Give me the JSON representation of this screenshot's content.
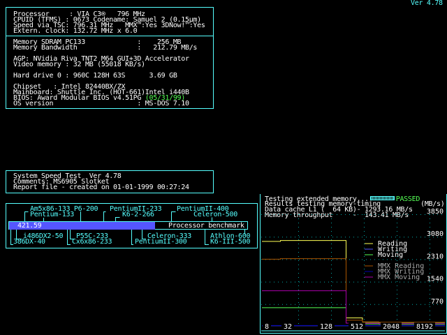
{
  "version": "Ver 4.78",
  "system": {
    "cpu": [
      "Processor     : VIA C3®   796 MHz",
      "CPUID (TFMS) : 0673 Codename: Samuel 2 (0.15µm)",
      "Speed via TSC: 796.31 MHz   MMX™:Yes 3DNow!™:Yes",
      "Extern. clock: 132.72 MHz x 6.0"
    ],
    "memory": [
      "Memory SDRAM PC133             :    256 MB",
      "Memory Bandwidth               :   212.79 MB/s"
    ],
    "video": [
      "AGP: NVidia Riva TNT2 M64 GUI+3D Accelerator",
      "Video memory : 32 MB (55018 KB/s)"
    ],
    "disk": "Hard drive 0 : 960C 128H 63S      3.69 GB",
    "chipset": "Chipset   : Intel 82440BX/ZX",
    "mainboard": "Mainboard: Shuttle Inc. (HOT-661)Intel i440B",
    "bios": "BIOS: Award Modular BIOS v4.51PG",
    "bios_date": "(05/31/99)",
    "os": "OS version                     : MS-DOS 7.10"
  },
  "report": [
    "System Speed Test  Ver 4.78",
    "Comments: MS6905 Slotket",
    "Report file - created on 01-01-1999 00:27:24"
  ],
  "benchmark": {
    "score": "421.59",
    "score_value": 421.59,
    "label": "Processor benchmark",
    "above": [
      "Am5x86-133 P6-200",
      "PentiumII-233",
      "PentiumII-400",
      "Pentium-133",
      "K6-2-266",
      "Celeron-500"
    ],
    "below": [
      "i486DX2-50",
      "P55C-233",
      "Celeron-333",
      "Athlon-600",
      "386DX-40",
      "Cx6x86-233",
      "PentiumII-300",
      "K6-III-500"
    ]
  },
  "memtest": {
    "status_text": "Testing extended memory...",
    "status": "PASSED",
    "lines": [
      "Results testing memory-timing          (MB/s)",
      "Data cache L1 (  64 KB)- 1293.16 MB/s",
      "Memory throughput     -  143.41 MB/s"
    ]
  },
  "chart_data": {
    "type": "line",
    "xscale": "log2",
    "xlabel_unit": "KB",
    "x": [
      4,
      8,
      16,
      32,
      64,
      128,
      256,
      512,
      1024,
      2048,
      4096,
      8192
    ],
    "xticks": [
      "8",
      "32",
      "128",
      "512",
      "2048",
      "8192"
    ],
    "yticks": [
      "770",
      "1540",
      "2310",
      "3080",
      "3850"
    ],
    "ylim": [
      0,
      3850
    ],
    "grid": true,
    "legend_placement": "right",
    "series": [
      {
        "name": "Reading",
        "color": "#ffff55",
        "values": [
          2920,
          2950,
          2950,
          2950,
          2950,
          300,
          150,
          140,
          140,
          140,
          140,
          140
        ]
      },
      {
        "name": "Writing",
        "color": "#5555ff",
        "values": [
          30,
          30,
          30,
          30,
          30,
          30,
          30,
          30,
          30,
          30,
          30,
          30
        ]
      },
      {
        "name": "Moving",
        "color": "#55ff55",
        "values": [
          650,
          650,
          650,
          650,
          650,
          120,
          90,
          80,
          80,
          80,
          80,
          80
        ]
      },
      {
        "name": "MMX Reading",
        "color": "#aa5500",
        "values": [
          2310,
          2330,
          2330,
          2330,
          2330,
          220,
          160,
          150,
          150,
          150,
          150,
          150
        ]
      },
      {
        "name": "MMX Writing",
        "color": "#0000aa",
        "values": [
          40,
          40,
          40,
          40,
          40,
          40,
          40,
          40,
          40,
          40,
          40,
          40
        ]
      },
      {
        "name": "MMX Moving",
        "color": "#aa00aa",
        "values": [
          1230,
          1230,
          1230,
          1230,
          1230,
          120,
          110,
          100,
          100,
          100,
          100,
          100
        ]
      }
    ]
  }
}
